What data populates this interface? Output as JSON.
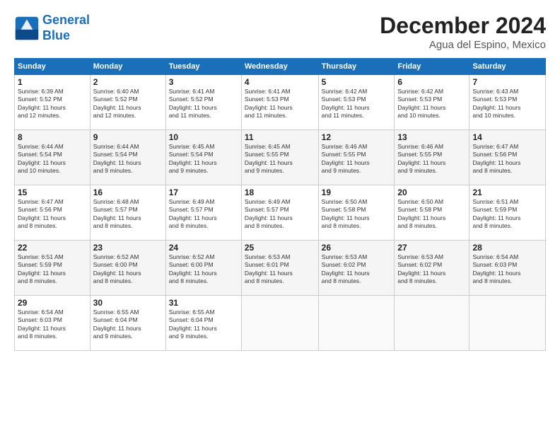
{
  "logo": {
    "line1": "General",
    "line2": "Blue"
  },
  "title": "December 2024",
  "location": "Agua del Espino, Mexico",
  "days_of_week": [
    "Sunday",
    "Monday",
    "Tuesday",
    "Wednesday",
    "Thursday",
    "Friday",
    "Saturday"
  ],
  "weeks": [
    [
      {
        "num": "1",
        "info": "Sunrise: 6:39 AM\nSunset: 5:52 PM\nDaylight: 11 hours\nand 12 minutes."
      },
      {
        "num": "2",
        "info": "Sunrise: 6:40 AM\nSunset: 5:52 PM\nDaylight: 11 hours\nand 12 minutes."
      },
      {
        "num": "3",
        "info": "Sunrise: 6:41 AM\nSunset: 5:52 PM\nDaylight: 11 hours\nand 11 minutes."
      },
      {
        "num": "4",
        "info": "Sunrise: 6:41 AM\nSunset: 5:53 PM\nDaylight: 11 hours\nand 11 minutes."
      },
      {
        "num": "5",
        "info": "Sunrise: 6:42 AM\nSunset: 5:53 PM\nDaylight: 11 hours\nand 11 minutes."
      },
      {
        "num": "6",
        "info": "Sunrise: 6:42 AM\nSunset: 5:53 PM\nDaylight: 11 hours\nand 10 minutes."
      },
      {
        "num": "7",
        "info": "Sunrise: 6:43 AM\nSunset: 5:53 PM\nDaylight: 11 hours\nand 10 minutes."
      }
    ],
    [
      {
        "num": "8",
        "info": "Sunrise: 6:44 AM\nSunset: 5:54 PM\nDaylight: 11 hours\nand 10 minutes."
      },
      {
        "num": "9",
        "info": "Sunrise: 6:44 AM\nSunset: 5:54 PM\nDaylight: 11 hours\nand 9 minutes."
      },
      {
        "num": "10",
        "info": "Sunrise: 6:45 AM\nSunset: 5:54 PM\nDaylight: 11 hours\nand 9 minutes."
      },
      {
        "num": "11",
        "info": "Sunrise: 6:45 AM\nSunset: 5:55 PM\nDaylight: 11 hours\nand 9 minutes."
      },
      {
        "num": "12",
        "info": "Sunrise: 6:46 AM\nSunset: 5:55 PM\nDaylight: 11 hours\nand 9 minutes."
      },
      {
        "num": "13",
        "info": "Sunrise: 6:46 AM\nSunset: 5:55 PM\nDaylight: 11 hours\nand 9 minutes."
      },
      {
        "num": "14",
        "info": "Sunrise: 6:47 AM\nSunset: 5:56 PM\nDaylight: 11 hours\nand 8 minutes."
      }
    ],
    [
      {
        "num": "15",
        "info": "Sunrise: 6:47 AM\nSunset: 5:56 PM\nDaylight: 11 hours\nand 8 minutes."
      },
      {
        "num": "16",
        "info": "Sunrise: 6:48 AM\nSunset: 5:57 PM\nDaylight: 11 hours\nand 8 minutes."
      },
      {
        "num": "17",
        "info": "Sunrise: 6:49 AM\nSunset: 5:57 PM\nDaylight: 11 hours\nand 8 minutes."
      },
      {
        "num": "18",
        "info": "Sunrise: 6:49 AM\nSunset: 5:57 PM\nDaylight: 11 hours\nand 8 minutes."
      },
      {
        "num": "19",
        "info": "Sunrise: 6:50 AM\nSunset: 5:58 PM\nDaylight: 11 hours\nand 8 minutes."
      },
      {
        "num": "20",
        "info": "Sunrise: 6:50 AM\nSunset: 5:58 PM\nDaylight: 11 hours\nand 8 minutes."
      },
      {
        "num": "21",
        "info": "Sunrise: 6:51 AM\nSunset: 5:59 PM\nDaylight: 11 hours\nand 8 minutes."
      }
    ],
    [
      {
        "num": "22",
        "info": "Sunrise: 6:51 AM\nSunset: 5:59 PM\nDaylight: 11 hours\nand 8 minutes."
      },
      {
        "num": "23",
        "info": "Sunrise: 6:52 AM\nSunset: 6:00 PM\nDaylight: 11 hours\nand 8 minutes."
      },
      {
        "num": "24",
        "info": "Sunrise: 6:52 AM\nSunset: 6:00 PM\nDaylight: 11 hours\nand 8 minutes."
      },
      {
        "num": "25",
        "info": "Sunrise: 6:53 AM\nSunset: 6:01 PM\nDaylight: 11 hours\nand 8 minutes."
      },
      {
        "num": "26",
        "info": "Sunrise: 6:53 AM\nSunset: 6:02 PM\nDaylight: 11 hours\nand 8 minutes."
      },
      {
        "num": "27",
        "info": "Sunrise: 6:53 AM\nSunset: 6:02 PM\nDaylight: 11 hours\nand 8 minutes."
      },
      {
        "num": "28",
        "info": "Sunrise: 6:54 AM\nSunset: 6:03 PM\nDaylight: 11 hours\nand 8 minutes."
      }
    ],
    [
      {
        "num": "29",
        "info": "Sunrise: 6:54 AM\nSunset: 6:03 PM\nDaylight: 11 hours\nand 8 minutes."
      },
      {
        "num": "30",
        "info": "Sunrise: 6:55 AM\nSunset: 6:04 PM\nDaylight: 11 hours\nand 9 minutes."
      },
      {
        "num": "31",
        "info": "Sunrise: 6:55 AM\nSunset: 6:04 PM\nDaylight: 11 hours\nand 9 minutes."
      },
      null,
      null,
      null,
      null
    ]
  ]
}
